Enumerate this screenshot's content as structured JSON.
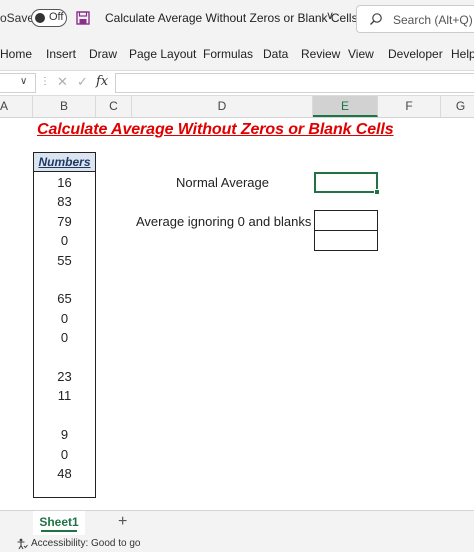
{
  "titlebar": {
    "autosave_label": "oSave",
    "toggle_state": "Off",
    "filename": "Calculate Average Without Zeros or Blank Cells.xlsx",
    "filename_chevron": "∨",
    "search_placeholder": "Search (Alt+Q)"
  },
  "ribbon": {
    "tabs": [
      "Home",
      "Insert",
      "Draw",
      "Page Layout",
      "Formulas",
      "Data",
      "Review",
      "View",
      "Developer",
      "Help"
    ]
  },
  "formula_bar": {
    "namebox_value": "",
    "formula_value": "",
    "fx": "fx",
    "cancel_glyph": "✕",
    "enter_glyph": "✓"
  },
  "columns": [
    "A",
    "B",
    "C",
    "D",
    "E",
    "F",
    "G"
  ],
  "selected_column": "E",
  "sheet": {
    "title": "Calculate Average Without Zeros or Blank Cells",
    "numbers_header": "Numbers",
    "numbers": [
      "16",
      "83",
      "79",
      "0",
      "55",
      "",
      "65",
      "0",
      "0",
      "",
      "23",
      "11",
      "",
      "9",
      "0",
      "48"
    ],
    "label_normal_average": "Normal Average",
    "label_average_ignoring": "Average ignoring 0 and blanks"
  },
  "tabs": {
    "sheets": [
      "Sheet1"
    ],
    "add_sheet_glyph": "+"
  },
  "status": {
    "accessibility": "Accessibility: Good to go"
  },
  "colors": {
    "excel_green": "#217346",
    "title_red": "#e00000",
    "header_fill": "#dbe5f1"
  }
}
